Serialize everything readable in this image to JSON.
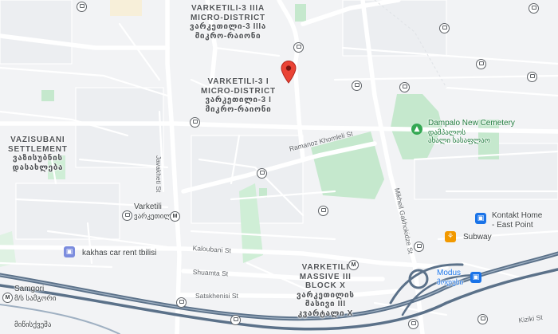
{
  "map": {
    "districts": {
      "varketili_3_iiia": {
        "en1": "VARKETILI-3 IIIA",
        "en2": "MICRO-DISTRICT",
        "ka1": "ვარკეთილი-3 IIIა",
        "ka2": "მიკრო-რაიონი"
      },
      "varketili_3_i": {
        "en1": "VARKETILI-3 I",
        "en2": "MICRO-DISTRICT",
        "ka1": "ვარკეთილი-3 I",
        "ka2": "მიკრო-რაიონი"
      },
      "vazisubani": {
        "en1": "VAZISUBANI",
        "en2": "SETTLEMENT",
        "ka1": "ვაზისუბნის",
        "ka2": "დასახლება"
      },
      "varketili_massive": {
        "en1": "VARKETILI",
        "en2": "MASSIVE III",
        "en3": "BLOCK X",
        "ka1": "ვარკეთილის",
        "ka2": "მასივი III",
        "ka3": "კვარტალი X"
      }
    },
    "streets": {
      "ramanoz": "Ramanoz Khomleli St",
      "javakheti": "Javakheti St",
      "mikheil": "Mikheil Gakhokidze St",
      "kaloubani": "Kaloubani St",
      "shuamta": "Shuamta St",
      "satskhenisi": "Satskhenisi St",
      "kiziki": "Kiziki St"
    },
    "places": {
      "varketili": "Varketili",
      "varketili_ka": "ვარკეთილი",
      "samgori": "Samgori",
      "samgori_ka": "მ/ს სამგორი",
      "bottom_left_ka": "მიწისქვეშა",
      "dampalo": "Dampalo New Cemetery",
      "dampalo_ka1": "დამპალოს",
      "dampalo_ka2": "ახალი სასაფლაო",
      "kontakt1": "Kontakt Home",
      "kontakt2": "- East Point",
      "subway": "Subway",
      "modus": "Modus",
      "modus_ka": "მოდუსი",
      "kakhas": "kakhas car rent tbilisi"
    },
    "icons": {
      "pin": "location-pin-icon",
      "metro": "metro-station-icon",
      "bus": "bus-stop-icon",
      "cemetery": "cemetery-icon",
      "shop": "shopping-bag-icon",
      "restaurant": "restaurant-icon",
      "car": "car-rental-icon"
    },
    "metro_glyph": "M",
    "colors": {
      "background": "#f2f3f5",
      "road": "#ffffff",
      "railway": "#5b7189",
      "park": "#c5e8cd",
      "park_dark": "#a8dbb4",
      "pin": "#ea4335",
      "poi_blue": "#1a73e8",
      "poi_orange": "#f29900",
      "poi_green": "#34a853",
      "poi_car": "#7b8cde"
    }
  }
}
